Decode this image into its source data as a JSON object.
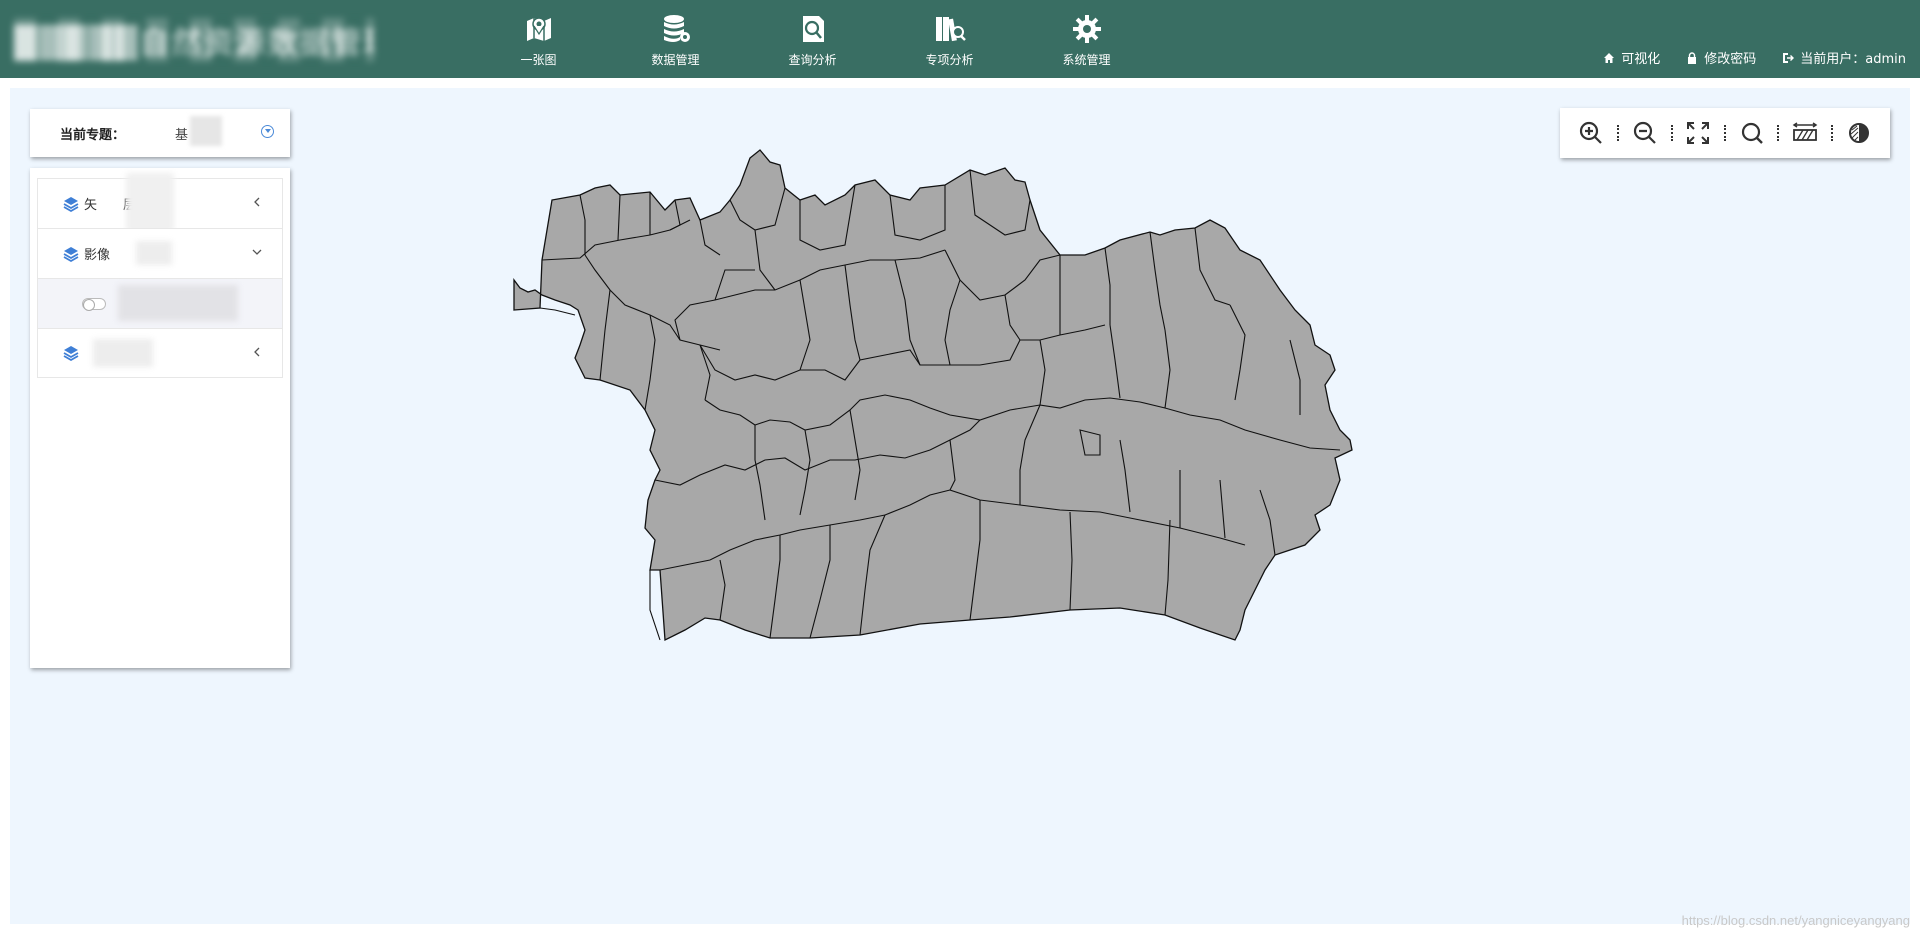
{
  "app": {
    "title": "█████自然资源数据管理平台"
  },
  "nav": [
    {
      "label": "一张图",
      "icon": "map-pin-icon"
    },
    {
      "label": "数据管理",
      "icon": "database-settings-icon"
    },
    {
      "label": "查询分析",
      "icon": "search-document-icon"
    },
    {
      "label": "专项分析",
      "icon": "books-search-icon"
    },
    {
      "label": "系统管理",
      "icon": "gear-icon"
    }
  ],
  "user_bar": {
    "visualize": "可视化",
    "change_password": "修改密码",
    "current_user": "当前用户：admin"
  },
  "subject": {
    "label": "当前专题：",
    "value": "基"
  },
  "layers": [
    {
      "label": "矢",
      "suffix": "层",
      "expanded": false
    },
    {
      "label": "影像",
      "suffix": "",
      "expanded": true
    },
    {
      "label": "",
      "suffix": "",
      "expanded": false
    }
  ],
  "map_tools": [
    "zoom-in-icon",
    "zoom-out-icon",
    "full-extent-icon",
    "search-icon",
    "measure-icon",
    "contrast-icon"
  ],
  "colors": {
    "header": "#396e63",
    "map_bg": "#eef6fe",
    "region_fill": "#a8a8a8",
    "accent": "#4b8ad8"
  },
  "watermark": "https://blog.csdn.net/yangniceyangyang"
}
